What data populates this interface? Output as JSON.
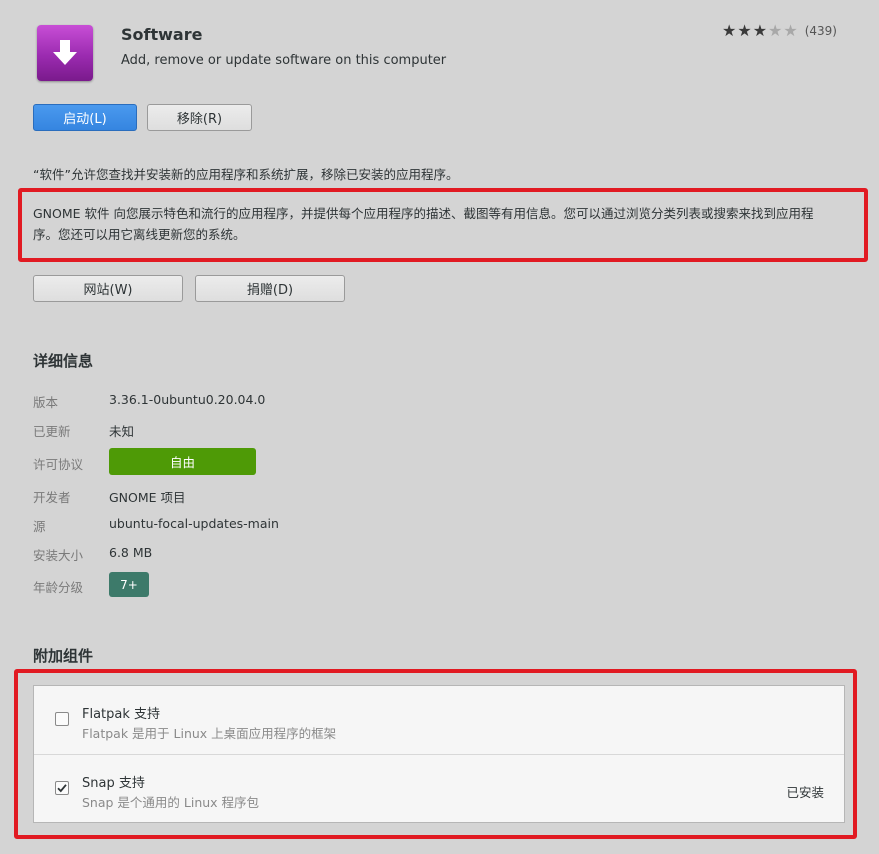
{
  "app": {
    "name": "Software",
    "summary": "Add, remove or update software on this computer",
    "icon": "download-arrow-icon",
    "rating": {
      "stars": 3,
      "max": 5,
      "review_count": "(439)"
    }
  },
  "actions": {
    "launch_label": "启动(L)",
    "remove_label": "移除(R)",
    "website_label": "网站(W)",
    "donate_label": "捐赠(D)"
  },
  "description": {
    "intro": "“软件”允许您查找并安装新的应用程序和系统扩展，移除已安装的应用程序。",
    "line1": "GNOME 软件 向您展示特色和流行的应用程序，并提供每个应用程序的描述、截图等有用信息。您可以通过浏览分类列表或搜索来找到应用程",
    "line2": "序。您还可以用它离线更新您的系统。"
  },
  "details": {
    "title": "详细信息",
    "version_label": "版本",
    "version": "3.36.1-0ubuntu0.20.04.0",
    "updated_label": "已更新",
    "updated": "未知",
    "license_label": "许可协议",
    "license": "自由",
    "developer_label": "开发者",
    "developer": "GNOME 项目",
    "source_label": "源",
    "source": "ubuntu-focal-updates-main",
    "size_label": "安装大小",
    "size": "6.8 MB",
    "age_label": "年龄分级",
    "age": "7+"
  },
  "addons": {
    "title": "附加组件",
    "items": [
      {
        "name": "Flatpak 支持",
        "desc": "Flatpak 是用于 Linux 上桌面应用程序的框架",
        "checked": false,
        "status": ""
      },
      {
        "name": "Snap 支持",
        "desc": "Snap 是个通用的 Linux 程序包",
        "checked": true,
        "status": "已安装"
      }
    ]
  },
  "colors": {
    "primary_button": "#3585e0",
    "license_badge": "#4e9a06",
    "age_badge": "#3d7a6a",
    "highlight_box": "#e11a22"
  }
}
